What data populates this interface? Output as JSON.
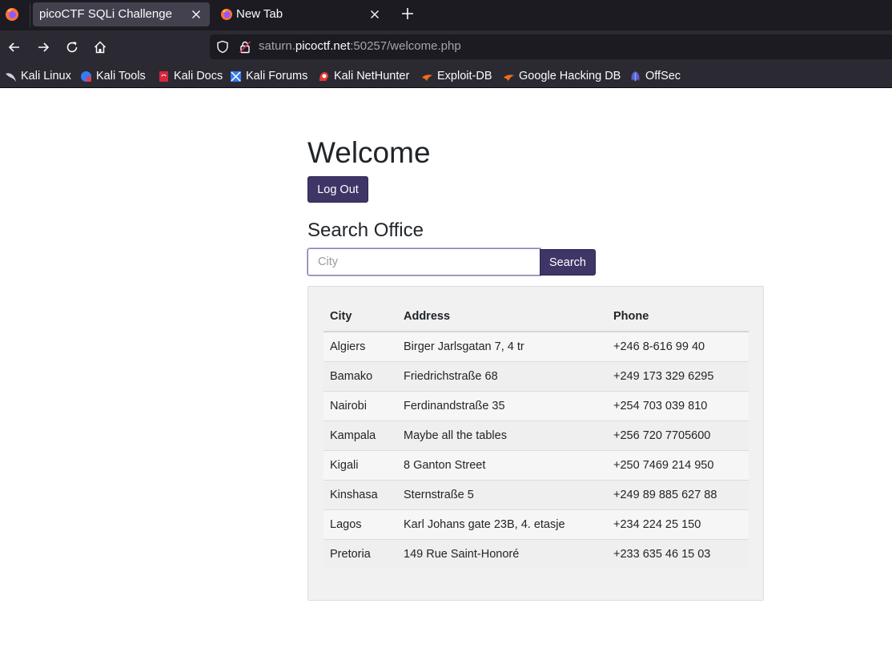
{
  "browser": {
    "tabs": [
      {
        "title": "picoCTF SQLi Challenge",
        "active": true
      },
      {
        "title": "New Tab",
        "active": false
      }
    ],
    "url": {
      "prefix": "saturn.",
      "domain": "picoctf.net",
      "suffix": ":50257/welcome.php"
    },
    "bookmarks": [
      {
        "label": "Kali Linux",
        "icon": "kali-dragon-icon"
      },
      {
        "label": "Kali Tools",
        "icon": "kali-tools-icon"
      },
      {
        "label": "Kali Docs",
        "icon": "kali-docs-icon"
      },
      {
        "label": "Kali Forums",
        "icon": "kali-forums-icon"
      },
      {
        "label": "Kali NetHunter",
        "icon": "kali-nethunter-icon"
      },
      {
        "label": "Exploit-DB",
        "icon": "exploit-db-icon"
      },
      {
        "label": "Google Hacking DB",
        "icon": "ghdb-icon"
      },
      {
        "label": "OffSec",
        "icon": "offsec-icon"
      }
    ]
  },
  "page": {
    "heading": "Welcome",
    "logout_label": "Log Out",
    "search_title": "Search Office",
    "search": {
      "placeholder": "City",
      "value": "",
      "button_label": "Search"
    },
    "accent_color": "#3f3566",
    "table": {
      "headers": [
        "City",
        "Address",
        "Phone"
      ],
      "rows": [
        [
          "Algiers",
          "Birger Jarlsgatan 7, 4 tr",
          "+246 8-616 99 40"
        ],
        [
          "Bamako",
          "Friedrichstraße 68",
          "+249 173 329 6295"
        ],
        [
          "Nairobi",
          "Ferdinandstraße 35",
          "+254 703 039 810"
        ],
        [
          "Kampala",
          "Maybe all the tables",
          "+256 720 7705600"
        ],
        [
          "Kigali",
          "8 Ganton Street",
          "+250 7469 214 950"
        ],
        [
          "Kinshasa",
          "Sternstraße 5",
          "+249 89 885 627 88"
        ],
        [
          "Lagos",
          "Karl Johans gate 23B, 4. etasje",
          "+234 224 25 150"
        ],
        [
          "Pretoria",
          "149 Rue Saint-Honoré",
          "+233 635 46 15 03"
        ]
      ]
    }
  }
}
